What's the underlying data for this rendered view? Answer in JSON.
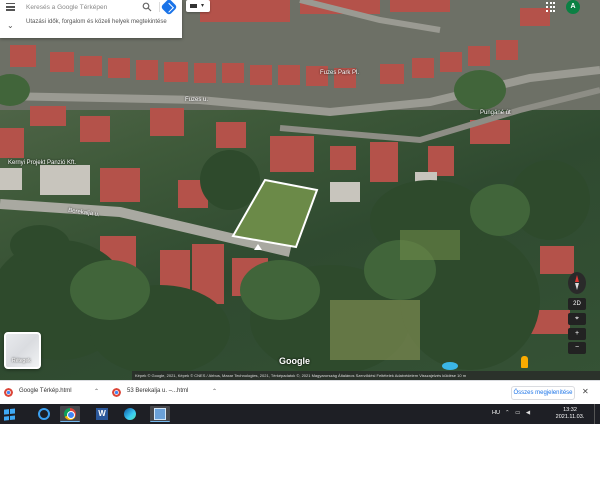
{
  "search": {
    "placeholder": "Keresés a Google Térképen",
    "suggestion": "Utazási idők, forgalom és közeli helyek megtekintése"
  },
  "account": {
    "initial": "A",
    "color": "#0b8043"
  },
  "map": {
    "road_labels": [
      "Berekalja u.",
      "Berekalja u.",
      "Fuzes u."
    ],
    "place_labels": [
      "Kernyi Projekt Panzió Kft.",
      "Pungáné út",
      "Fuzes Park Pl."
    ],
    "layers_label": "Rétegek",
    "logo": "Google",
    "attribution": "Képek © Google, 2021, Képek © CNES / Airbus, Maxar Technologies, 2021, Térképadatok ©, 2021   Magyarország   Általános Szerződési Feltételek   Adatvédelem   Visszajelzés küldése   10 m",
    "controls": {
      "tilt": "2D",
      "zoom_in": "+",
      "zoom_out": "−",
      "locate": "⌖"
    }
  },
  "downloads": {
    "items": [
      {
        "name": "Google Térkép.html",
        "icon": "chrome-file-icon"
      },
      {
        "name": "53 Berekalja u. –...html",
        "icon": "chrome-file-icon"
      }
    ],
    "show_all": "Összes megjelenítése",
    "close": "✕"
  },
  "taskbar": {
    "apps": [
      "start",
      "internet-explorer",
      "chrome",
      "word",
      "edge",
      "photos"
    ],
    "word_glyph": "W",
    "language": "HU",
    "tray": "⌃ ▭ ◀",
    "time": "13:32",
    "date": "2021.11.03."
  },
  "colors": {
    "accent": "#1a73e8",
    "taskbar": "#1e1f25",
    "plot_outline": "#ffffff"
  }
}
